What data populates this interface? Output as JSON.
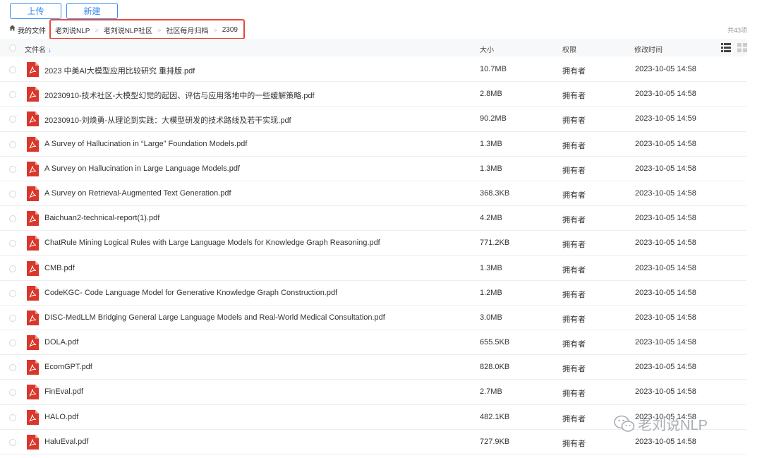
{
  "toolbar": {
    "upload_label": "上传",
    "new_label": "新建"
  },
  "breadcrumb": {
    "root": "我的文件",
    "items": [
      "老刘说NLP",
      "老刘说NLP社区",
      "社区每月归档",
      "2309"
    ],
    "separator": ">",
    "total": "共43项"
  },
  "table": {
    "headers": {
      "name": "文件名",
      "size": "大小",
      "permission": "权限",
      "modified": "修改时间"
    },
    "rows": [
      {
        "name": "2023 中美AI大模型应用比较研究 重排版.pdf",
        "size": "10.7MB",
        "permission": "拥有者",
        "modified": "2023-10-05 14:58"
      },
      {
        "name": "20230910-技术社区-大模型幻觉的起因、评估与应用落地中的一些缓解策略.pdf",
        "size": "2.8MB",
        "permission": "拥有者",
        "modified": "2023-10-05 14:58"
      },
      {
        "name": "20230910-刘焕勇-从理论到实践：大模型研发的技术路线及若干实现.pdf",
        "size": "90.2MB",
        "permission": "拥有者",
        "modified": "2023-10-05 14:59"
      },
      {
        "name": "A Survey of Hallucination in “Large” Foundation Models.pdf",
        "size": "1.3MB",
        "permission": "拥有者",
        "modified": "2023-10-05 14:58"
      },
      {
        "name": "A Survey on Hallucination in Large Language Models.pdf",
        "size": "1.3MB",
        "permission": "拥有者",
        "modified": "2023-10-05 14:58"
      },
      {
        "name": "A Survey on Retrieval-Augmented Text Generation.pdf",
        "size": "368.3KB",
        "permission": "拥有者",
        "modified": "2023-10-05 14:58"
      },
      {
        "name": "Baichuan2-technical-report(1).pdf",
        "size": "4.2MB",
        "permission": "拥有者",
        "modified": "2023-10-05 14:58"
      },
      {
        "name": "ChatRule Mining Logical Rules with Large Language Models for Knowledge Graph Reasoning.pdf",
        "size": "771.2KB",
        "permission": "拥有者",
        "modified": "2023-10-05 14:58"
      },
      {
        "name": "CMB.pdf",
        "size": "1.3MB",
        "permission": "拥有者",
        "modified": "2023-10-05 14:58"
      },
      {
        "name": "CodeKGC- Code Language Model for Generative Knowledge Graph Construction.pdf",
        "size": "1.2MB",
        "permission": "拥有者",
        "modified": "2023-10-05 14:58"
      },
      {
        "name": "DISC-MedLLM Bridging General Large Language Models and Real-World Medical Consultation.pdf",
        "size": "3.0MB",
        "permission": "拥有者",
        "modified": "2023-10-05 14:58"
      },
      {
        "name": "DOLA.pdf",
        "size": "655.5KB",
        "permission": "拥有者",
        "modified": "2023-10-05 14:58"
      },
      {
        "name": "EcomGPT.pdf",
        "size": "828.0KB",
        "permission": "拥有者",
        "modified": "2023-10-05 14:58"
      },
      {
        "name": "FinEval.pdf",
        "size": "2.7MB",
        "permission": "拥有者",
        "modified": "2023-10-05 14:58"
      },
      {
        "name": "HALO.pdf",
        "size": "482.1KB",
        "permission": "拥有者",
        "modified": "2023-10-05 14:58"
      },
      {
        "name": "HaluEval.pdf",
        "size": "727.9KB",
        "permission": "拥有者",
        "modified": "2023-10-05 14:58"
      }
    ]
  },
  "watermark": {
    "text": "老刘说NLP"
  },
  "colors": {
    "accent": "#3b8bf0",
    "highlight_border": "#e8473a",
    "pdf_red": "#d9372b"
  },
  "icons": {
    "home": "home-icon",
    "file": "pdf-file-icon",
    "sort": "sort-down-icon",
    "list_view": "list-view-icon",
    "grid_view": "grid-view-icon"
  }
}
